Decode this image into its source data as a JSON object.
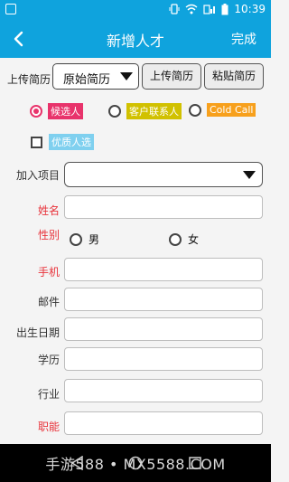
{
  "status": {
    "time": "10:39"
  },
  "header": {
    "title": "新增人才",
    "done_label": "完成"
  },
  "resume": {
    "label": "上传简历",
    "select_value": "原始简历",
    "upload_button": "上传简历",
    "paste_button": "粘贴简历"
  },
  "source_options": [
    {
      "label": "候选人",
      "color": "#e8336b",
      "checked": true
    },
    {
      "label": "客户联系人",
      "color": "#d1c100",
      "checked": false
    },
    {
      "label": "Cold Call",
      "color": "#f7a01c",
      "checked": false
    }
  ],
  "quality_checkbox": {
    "label": "优质人选",
    "color": "#7fd0ef"
  },
  "fields": {
    "project": "加入项目",
    "name": "姓名",
    "gender": "性别",
    "male": "男",
    "female": "女",
    "phone": "手机",
    "email": "邮件",
    "birthday": "出生日期",
    "education": "学历",
    "industry": "行业",
    "role": "职能"
  },
  "watermark": "手游588 • MX5588.COM"
}
